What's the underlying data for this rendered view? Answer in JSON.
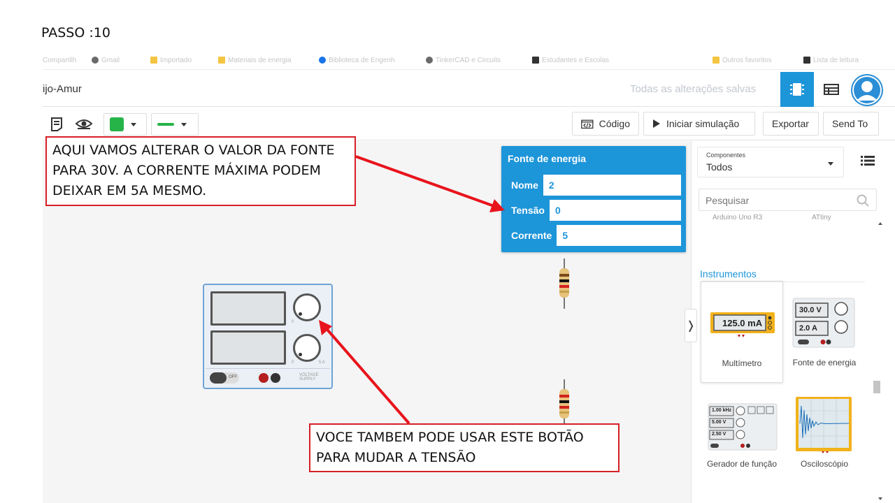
{
  "slide": {
    "title": "PASSO :10"
  },
  "bookmarks": [
    "Compartilh",
    "Gmail",
    "Importado",
    "Materiais de energia",
    "Biblioteca de Engenh",
    "TinkerCAD e Circuits",
    "Estudantes e Escolas",
    "Outros favoritos",
    "Lista de leitura"
  ],
  "header": {
    "project_name": "ijo-Amur",
    "saved_status": "Todas as alterações salvas"
  },
  "toolbar": {
    "code_label": "Código",
    "simulate_label": "Iniciar simulação",
    "export_label": "Exportar",
    "send_label": "Send To",
    "fill_color": "#26b348"
  },
  "properties": {
    "title": "Fonte de energia",
    "fields": [
      {
        "label": "Nome",
        "value": "2"
      },
      {
        "label": "Tensão",
        "value": "0"
      },
      {
        "label": "Corrente",
        "value": "5"
      }
    ]
  },
  "psu": {
    "off_label": "OFF",
    "knob1_min": "0",
    "knob2_min": "0",
    "knob2_max": "5 A",
    "brand": "VOLTAGE SUPPLY"
  },
  "panel": {
    "components_small": "Componentes",
    "components_value": "Todos",
    "search_placeholder": "Pesquisar",
    "ghost_left": "Arduino Uno R3",
    "ghost_right": "ATtiny",
    "section": "Instrumentos",
    "items": [
      {
        "label": "Multímetro",
        "display": "125.0 mA"
      },
      {
        "label": "Fonte de energia",
        "display_v": "30.0 V",
        "display_a": "2.0 A"
      },
      {
        "label": "Gerador de função",
        "f1": "1.00 kHz",
        "f2": "5.00 V",
        "f3": "2.50 V"
      },
      {
        "label": "Osciloscópio"
      }
    ]
  },
  "annotations": {
    "top": "AQUI VAMOS ALTERAR O VALOR DA FONTE PARA 30V. A CORRENTE MÁXIMA PODEM DEIXAR EM 5A MESMO.",
    "bottom": "VOCE TAMBEM PODE USAR ESTE BOTÃO PARA MUDAR A TENSÃO"
  },
  "colors": {
    "accent": "#1d95d9",
    "annotation_border": "#d61f26",
    "arrow": "#e8141c"
  }
}
